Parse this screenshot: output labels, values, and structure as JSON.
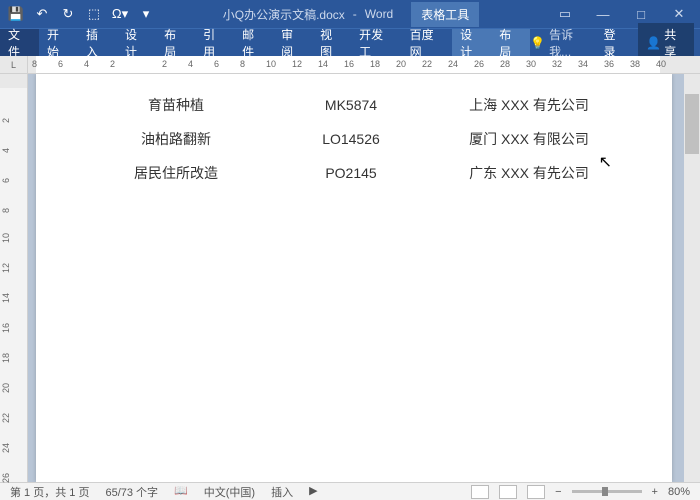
{
  "titlebar": {
    "doc_title": "小Q办公演示文稿.docx",
    "app_name": "Word",
    "context_tool": "表格工具"
  },
  "qat": {
    "save": "💾",
    "undo": "↶",
    "redo": "↻",
    "mode": "⬚"
  },
  "tabs": {
    "file": "文件",
    "home": "开始",
    "insert": "插入",
    "design": "设计",
    "layout": "布局",
    "references": "引用",
    "mailings": "邮件",
    "review": "审阅",
    "view": "视图",
    "developer": "开发工",
    "baidu": "百度网",
    "ctx_design": "设计",
    "ctx_layout": "布局"
  },
  "ribbon_right": {
    "tell_me": "告诉我...",
    "login": "登录",
    "share": "共享"
  },
  "ruler_h": [
    "8",
    "6",
    "4",
    "2",
    "",
    "2",
    "4",
    "6",
    "8",
    "10",
    "12",
    "14",
    "16",
    "18",
    "20",
    "22",
    "24",
    "26",
    "28",
    "30",
    "32",
    "34",
    "36",
    "38",
    "40"
  ],
  "ruler_v": [
    "",
    "2",
    "4",
    "6",
    "8",
    "10",
    "12",
    "14",
    "16",
    "18",
    "20",
    "22",
    "24",
    "26"
  ],
  "table_rows": [
    {
      "c1": "育苗种植",
      "c2": "MK5874",
      "c3": "上海 XXX 有先公司"
    },
    {
      "c1": "油柏路翻新",
      "c2": "LO14526",
      "c3": "厦门 XXX 有限公司"
    },
    {
      "c1": "居民住所改造",
      "c2": "PO2145",
      "c3": "广东 XXX 有先公司"
    }
  ],
  "status": {
    "page": "第 1 页，共 1 页",
    "words": "65/73 个字",
    "lang": "中文(中国)",
    "insert": "插入",
    "zoom": "80%"
  }
}
